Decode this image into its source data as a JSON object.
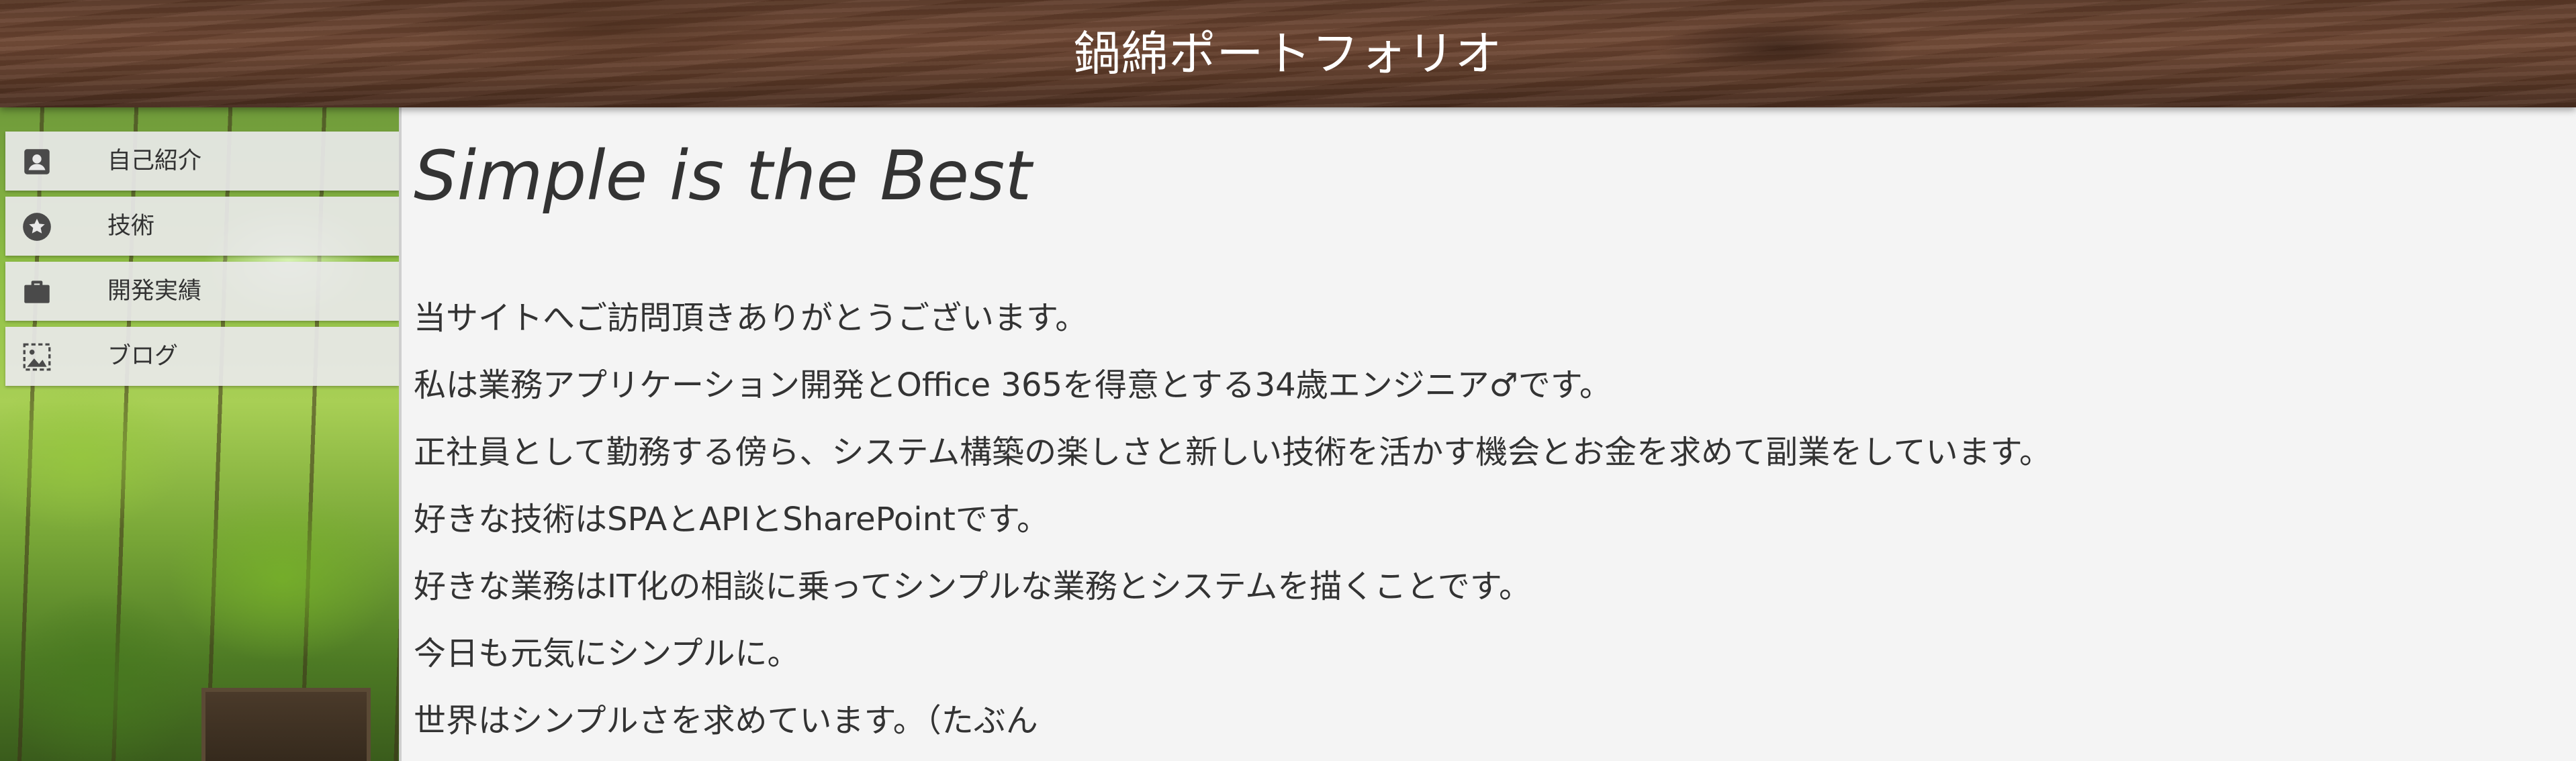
{
  "header": {
    "title": "鍋綿ポートフォリオ"
  },
  "sidebar": {
    "items": [
      {
        "label": "自己紹介",
        "icon": "person-icon"
      },
      {
        "label": "技術",
        "icon": "star-icon"
      },
      {
        "label": "開発実績",
        "icon": "briefcase-icon"
      },
      {
        "label": "ブログ",
        "icon": "image-icon"
      }
    ]
  },
  "main": {
    "heading": "Simple is the Best",
    "paragraphs": [
      "当サイトへご訪問頂きありがとうございます。",
      "私は業務アプリケーション開発とOffice 365を得意とする34歳エンジニア♂です。",
      "正社員として勤務する傍ら、システム構築の楽しさと新しい技術を活かす機会とお金を求めて副業をしています。",
      "好きな技術はSPAとAPIとSharePointです。",
      "好きな業務はIT化の相談に乗ってシンプルな業務とシステムを描くことです。",
      "今日も元気にシンプルに。",
      "世界はシンプルさを求めています。（たぶん"
    ]
  },
  "colors": {
    "text": "#333333",
    "nav_bg": "#e8e8e8",
    "icon": "#4a4a4a",
    "header_wood": "#5d3a28",
    "content_bg": "#f4f4f4"
  }
}
